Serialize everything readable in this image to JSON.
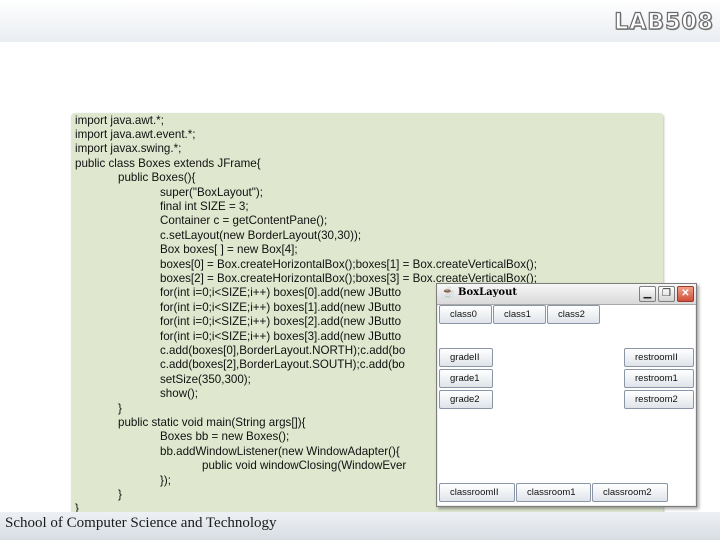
{
  "logo": {
    "text": "LAB508"
  },
  "footer": {
    "text": "School of Computer Science and Technology"
  },
  "code": {
    "lines": [
      "import java.awt.*;",
      "import java.awt.event.*;",
      "import javax.swing.*;",
      "public class Boxes extends JFrame{",
      "public Boxes(){",
      "super(\"BoxLayout\");",
      "final int SIZE = 3;",
      "Container c = getContentPane();",
      "c.setLayout(new BorderLayout(30,30));",
      "Box boxes[ ] = new Box[4];",
      "boxes[0] = Box.createHorizontalBox();boxes[1] = Box.createVerticalBox();",
      "boxes[2] = Box.createHorizontalBox();boxes[3] = Box.createVerticalBox();",
      "for(int i=0;i<SIZE;i++) boxes[0].add(new JButto",
      "for(int i=0;i<SIZE;i++) boxes[1].add(new JButto",
      "for(int i=0;i<SIZE;i++) boxes[2].add(new JButto",
      "for(int i=0;i<SIZE;i++) boxes[3].add(new JButto",
      "c.add(boxes[0],BorderLayout.NORTH);c.add(bo",
      "c.add(boxes[2],BorderLayout.SOUTH);c.add(bo",
      "setSize(350,300);",
      "show();",
      "}",
      "public static void main(String args[]){",
      "Boxes bb = new Boxes();",
      "bb.addWindowListener(new WindowAdapter(){",
      "public void windowClosing(WindowEver",
      "});",
      "}",
      "}"
    ]
  },
  "window": {
    "title": "BoxLayout",
    "icon": "java-cup-icon",
    "minimize_symbol": "▁",
    "maximize_symbol": "❐",
    "close_symbol": "✕",
    "north": [
      "class0",
      "class1",
      "class2"
    ],
    "west": [
      "gradeII",
      "grade1",
      "grade2"
    ],
    "east": [
      "restroomII",
      "restroom1",
      "restroom2"
    ],
    "south": [
      "classroomII",
      "classroom1",
      "classroom2"
    ]
  }
}
